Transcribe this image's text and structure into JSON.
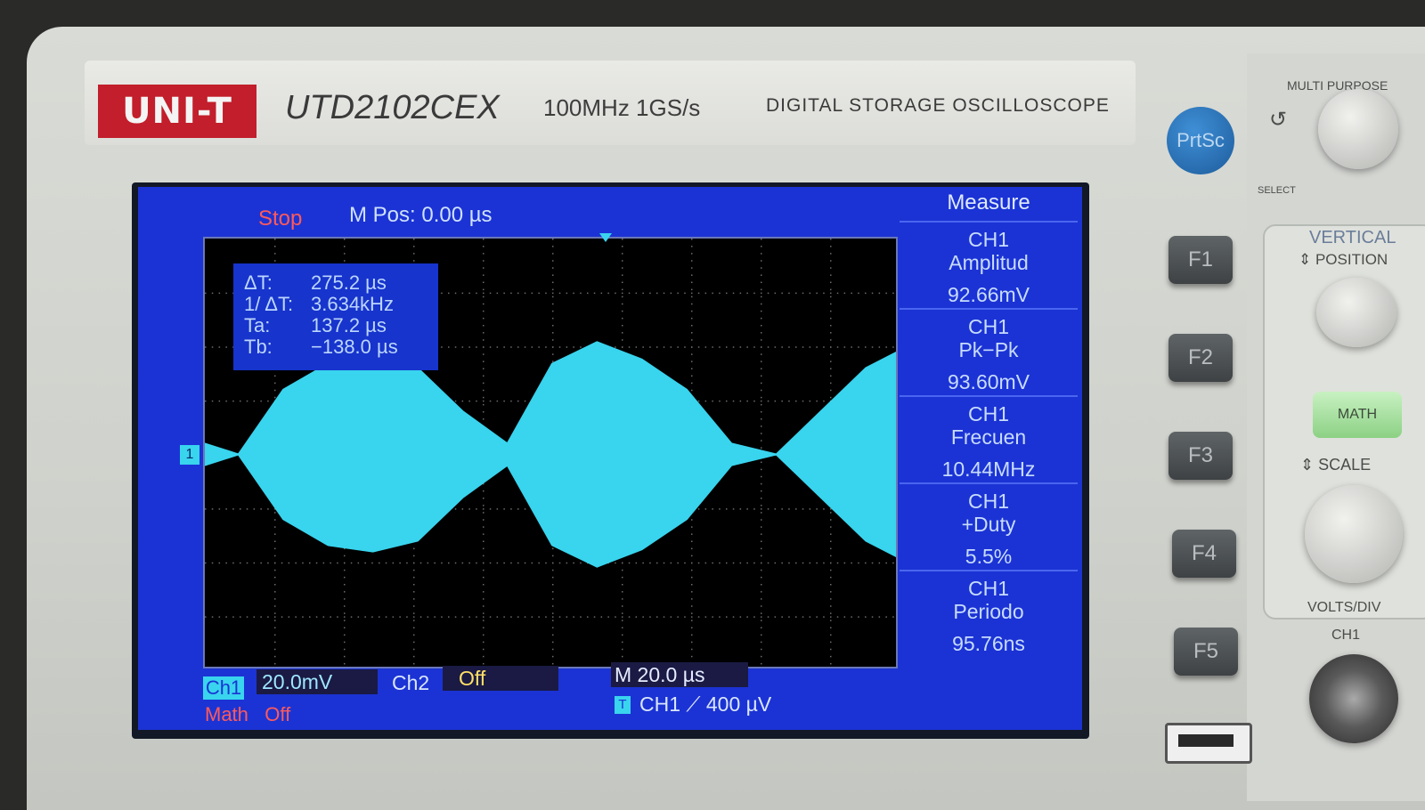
{
  "device": {
    "brand": "UNI-T",
    "model": "UTD2102CEX",
    "specs": "100MHz  1GS/s",
    "type": "DIGITAL STORAGE OSCILLOSCOPE"
  },
  "status": {
    "run_state": "Stop",
    "mpos": "M Pos: 0.00 µs"
  },
  "cursor": {
    "dt_label": "ΔT:",
    "dt_value": "275.2 µs",
    "inv_label": "1/ ΔT:",
    "inv_value": "3.634kHz",
    "ta_label": "Ta:",
    "ta_value": "137.2 µs",
    "tb_label": "Tb:",
    "tb_value": "−138.0 µs"
  },
  "measure": {
    "title": "Measure",
    "items": [
      {
        "source": "CH1",
        "name": "Amplitud",
        "value": "92.66mV"
      },
      {
        "source": "CH1",
        "name": "Pk−Pk",
        "value": "93.60mV"
      },
      {
        "source": "CH1",
        "name": "Frecuen",
        "value": "10.44MHz"
      },
      {
        "source": "CH1",
        "name": "+Duty",
        "value": "5.5%"
      },
      {
        "source": "CH1",
        "name": "Periodo",
        "value": "95.76ns"
      }
    ]
  },
  "bottom": {
    "ch1_tag": "Ch1",
    "ch1_scale": "20.0mV",
    "ch2_label": "Ch2",
    "ch2_state": "Off",
    "timebase": "M 20.0 µs",
    "trigger_tag": "T",
    "trigger": "CH1  ⟋   400 µV",
    "math_label": "Math",
    "math_state": "Off"
  },
  "channel_marker": "1",
  "buttons": {
    "prtsc": "PrtSc",
    "f1": "F1",
    "f2": "F2",
    "f3": "F3",
    "f4": "F4",
    "f5": "F5",
    "math": "MATH"
  },
  "panel_labels": {
    "multi": "MULTI PURPOSE",
    "select": "SELECT",
    "vertical": "VERTICAL",
    "position": "POSITION",
    "scale": "SCALE",
    "voltsdiv": "VOLTS/DIV",
    "ch1": "CH1"
  },
  "colors": {
    "screen_bg": "#1b33d4",
    "trace": "#39d4ee",
    "stop": "#ff5a5a",
    "ch2_off": "#ffe066"
  },
  "chart_data": {
    "type": "area",
    "x": [
      -155,
      -140,
      -120,
      -100,
      -80,
      -60,
      -40,
      -20,
      0,
      20,
      40,
      60,
      80,
      100,
      120,
      140,
      155
    ],
    "envelope_top": [
      5,
      0,
      30,
      42,
      45,
      40,
      20,
      5,
      42,
      52,
      44,
      30,
      5,
      0,
      20,
      40,
      48
    ],
    "envelope_bottom": [
      -5,
      0,
      -30,
      -42,
      -45,
      -40,
      -20,
      -5,
      -42,
      -52,
      -44,
      -30,
      -5,
      0,
      -20,
      -40,
      -48
    ],
    "xlabel": "",
    "ylabel": "",
    "grid": true
  }
}
